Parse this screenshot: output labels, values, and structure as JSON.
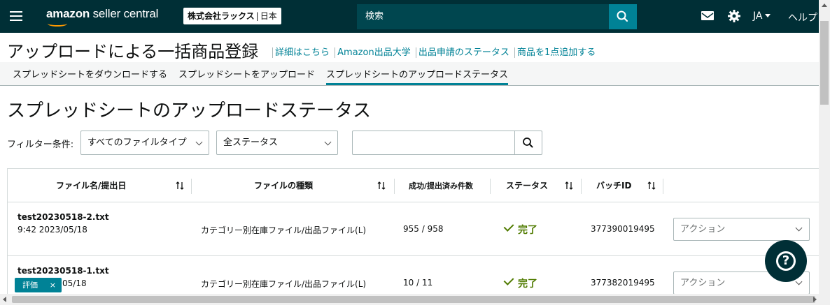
{
  "header": {
    "logo_brand": "amazon",
    "logo_product": "seller central",
    "store_name": "株式会社ラックス",
    "store_country": "日本",
    "search_placeholder": "検索",
    "language": "JA",
    "help_label": "ヘルプ",
    "icons": [
      "menu-icon",
      "search-icon",
      "mail-icon",
      "gear-icon"
    ]
  },
  "page": {
    "title": "アップロードによる一括商品登録",
    "links": [
      "詳細はこちら",
      "Amazon出品大学",
      "出品申請のステータス",
      "商品を1点追加する"
    ]
  },
  "tabs": [
    {
      "label": "スプレッドシートをダウンロードする",
      "active": false
    },
    {
      "label": "スプレッドシートをアップロード",
      "active": false
    },
    {
      "label": "スプレッドシートのアップロードステータス",
      "active": true
    }
  ],
  "section": {
    "title": "スプレッドシートのアップロードステータス"
  },
  "filters": {
    "label": "フィルター条件:",
    "file_type": "すべてのファイルタイプ",
    "status": "全ステータス",
    "search_value": ""
  },
  "table": {
    "columns": [
      "ファイル名/提出日",
      "ファイルの種類",
      "成功/提出済み件数",
      "ステータス",
      "バッチID"
    ],
    "rows": [
      {
        "file_name": "test20230518-2.txt",
        "submitted": "9:42 2023/05/18",
        "file_type": "カテゴリー別在庫ファイル/出品ファイル(L)",
        "counts": "955 / 958",
        "status": "完了",
        "batch_id": "377390019495",
        "action_placeholder": "アクション"
      },
      {
        "file_name": "test20230518-1.txt",
        "submitted": "9:...05/18",
        "submitted_visible": "05/18",
        "file_type": "カテゴリー別在庫ファイル/出品ファイル(L)",
        "counts": "10 / 11",
        "status": "完了",
        "batch_id": "377382019495",
        "action_placeholder": "アクション"
      }
    ]
  },
  "feedback": {
    "label": "評価",
    "close": "×"
  },
  "colors": {
    "topbar": "#002f36",
    "accent": "#008296",
    "success": "#507b00",
    "logo_smile": "#ff9900"
  }
}
